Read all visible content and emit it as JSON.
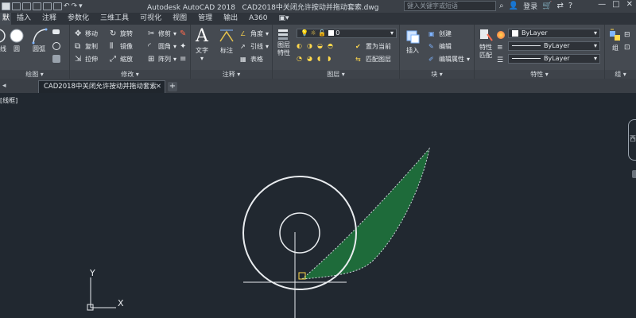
{
  "titlebar": {
    "app_title": "Autodesk AutoCAD 2018",
    "doc_title": "CAD2018中关闭允许按动并拖动套索.dwg",
    "search_placeholder": "键入关键字或短语",
    "login": "登录",
    "window_buttons": [
      "—",
      "□",
      "✕"
    ]
  },
  "tabs": [
    "默认",
    "插入",
    "注释",
    "参数化",
    "三维工具",
    "可视化",
    "视图",
    "管理",
    "输出",
    "A360"
  ],
  "active_tab_index": 0,
  "ribbon": {
    "draw_panel": {
      "title": "绘图",
      "big_tools": [
        "线",
        "圆",
        "圆弧"
      ]
    },
    "modify_panel": {
      "title": "修改",
      "rows": [
        [
          "移动",
          "旋转",
          "修剪"
        ],
        [
          "复制",
          "镜像",
          "圆角"
        ],
        [
          "拉伸",
          "缩放",
          "阵列"
        ]
      ]
    },
    "annotation_panel": {
      "title": "注释",
      "big_tools": [
        "文字",
        "标注"
      ],
      "rows": [
        "角度",
        "引线",
        "表格"
      ]
    },
    "layers_panel": {
      "title": "图层",
      "big_tool": "图层特性",
      "layer_value": "0",
      "rows": [
        "置为当前",
        "匹配图层"
      ]
    },
    "block_panel": {
      "title": "块",
      "big_tool": "插入",
      "rows": [
        "创建",
        "编辑",
        "编辑属性"
      ]
    },
    "properties_panel": {
      "title": "特性",
      "big_tool": "特性匹配",
      "color_value": "ByLayer",
      "linetype_value": "ByLayer",
      "lineweight_value": "ByLayer"
    },
    "group_panel": {
      "title": "组",
      "big_tool": "组"
    }
  },
  "doc_tab": {
    "label": "CAD2018中关闭允许按动并拖动套索"
  },
  "viewport_label": "[线框]",
  "viewcube_label": "西",
  "ucs": {
    "x_label": "X",
    "y_label": "Y"
  }
}
